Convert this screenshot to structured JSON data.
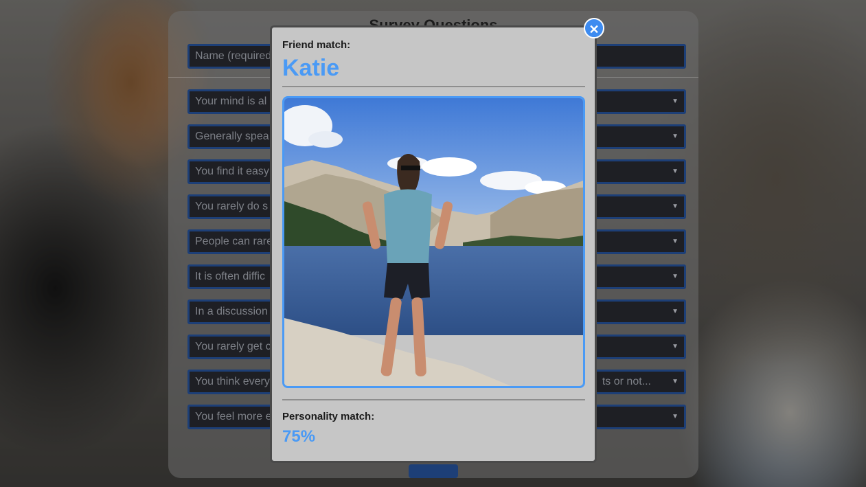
{
  "survey": {
    "title": "Survey Questions",
    "name_placeholder": "Name (required)",
    "questions": [
      {
        "text": "Your mind is al",
        "right": ""
      },
      {
        "text": "Generally spea",
        "right": ""
      },
      {
        "text": "You find it easy",
        "right": ""
      },
      {
        "text": "You rarely do s",
        "right": ""
      },
      {
        "text": "People can rare",
        "right": ""
      },
      {
        "text": "It is often diffic",
        "right": ""
      },
      {
        "text": "In a discussion",
        "right": ""
      },
      {
        "text": "You rarely get c",
        "right": ""
      },
      {
        "text": "You think every",
        "right": "ts or not..."
      },
      {
        "text": "You feel more e",
        "right": ""
      }
    ]
  },
  "modal": {
    "friend_label": "Friend match:",
    "friend_name": "Katie",
    "personality_label": "Personality match:",
    "personality_value": "75%",
    "close_icon": "close-icon",
    "photo_icon": "profile-photo"
  },
  "colors": {
    "accent": "#4a9af5",
    "close_button": "#3d8bf0",
    "modal_bg": "#c6c6c6",
    "field_border": "#1d3f77"
  }
}
